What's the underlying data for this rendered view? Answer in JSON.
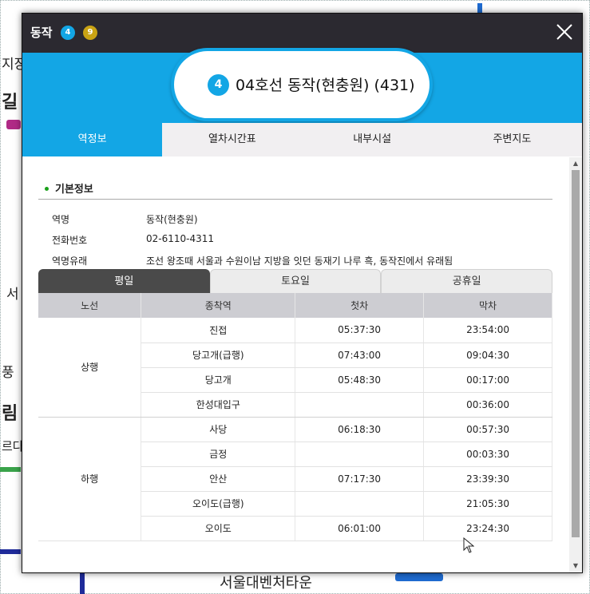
{
  "dialog": {
    "title": "동작",
    "badges": [
      {
        "label": "4",
        "color": "#13a6e5"
      },
      {
        "label": "9",
        "color": "#c9a314"
      }
    ],
    "close_icon": "close-icon"
  },
  "station": {
    "line_number": "4",
    "name": "04호선 동작(현충원) (431)",
    "accent": "#13a6e5"
  },
  "tabs": [
    {
      "label": "역정보",
      "active": true
    },
    {
      "label": "열차시간표",
      "active": false
    },
    {
      "label": "내부시설",
      "active": false
    },
    {
      "label": "주변지도",
      "active": false
    }
  ],
  "basic_info": {
    "title": "기본정보",
    "rows": [
      {
        "label": "역명",
        "value": "동작(현충원)"
      },
      {
        "label": "전화번호",
        "value": "02-6110-4311"
      },
      {
        "label": "역명유래",
        "value": "조선 왕조때 서울과 수원이남 지방을 잇던 동재기 나루 흑, 동작진에서 유래됨"
      }
    ]
  },
  "day_tabs": [
    {
      "label": "평일",
      "active": true
    },
    {
      "label": "토요일",
      "active": false
    },
    {
      "label": "공휴일",
      "active": false
    }
  ],
  "timetable": {
    "headers": [
      "노선",
      "종착역",
      "첫차",
      "막차"
    ],
    "groups": [
      {
        "direction": "상행",
        "rows": [
          {
            "dest": "진접",
            "first": "05:37:30",
            "last": "23:54:00"
          },
          {
            "dest": "당고개(급행)",
            "first": "07:43:00",
            "last": "09:04:30"
          },
          {
            "dest": "당고개",
            "first": "05:48:30",
            "last": "00:17:00"
          },
          {
            "dest": "한성대입구",
            "first": "",
            "last": "00:36:00"
          }
        ]
      },
      {
        "direction": "하행",
        "rows": [
          {
            "dest": "사당",
            "first": "06:18:30",
            "last": "00:57:30"
          },
          {
            "dest": "금정",
            "first": "",
            "last": "00:03:30"
          },
          {
            "dest": "안산",
            "first": "07:17:30",
            "last": "23:39:30"
          },
          {
            "dest": "오이도(급행)",
            "first": "",
            "last": "21:05:30"
          },
          {
            "dest": "오이도",
            "first": "06:01:00",
            "last": "23:24:30"
          }
        ]
      }
    ]
  },
  "background_map": {
    "labels": [
      "지장",
      "길",
      "서",
      "풍",
      "림",
      "르다",
      "서울대벤처타운"
    ]
  }
}
